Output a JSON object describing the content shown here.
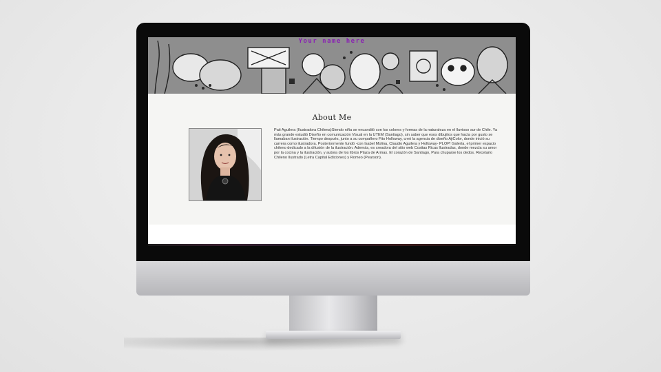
{
  "site": {
    "name": "Your name here"
  },
  "about": {
    "heading": "About Me",
    "bio": "Pati Aguilera (Ilustradora Chilena)Siendo niña se encandiló con los colores y formas de la naturaleza en el lluvioso sur de Chile. Ya más grande estudió Diseño en comunicación Visual en la UTEM (Santiago), sin saber que esos dibujitos que hacía por gusto se llamaban ilustración. Tiempo después, junto a su compañero Fito Holloway, creó la agencia de diseño AjiColor, donde inició su carrera como ilustradora. Posteriormente fundó -con Isabel Molina, Claudio Aguilera y Holloway- PLOP! Galería, el primer espacio chileno dedicado a la difusión de la ilustración. Además, es creadora del sitio web Cositas Ricas Ilustradas, donde mezcla su amor por la cocina y la ilustración, y autora de los libros Plaza de Armas. El corazón de Santiago, Para chuparse los dedos. Recetario Chileno Ilustrado (Letra Capital Ediciones) y Romeo (Pearson).",
    "photo_icon": "portrait-photo"
  },
  "colors": {
    "site_name": "#8a1fb5",
    "bezel": "#0a0a0a",
    "page_bg": "#f5f5f3"
  }
}
